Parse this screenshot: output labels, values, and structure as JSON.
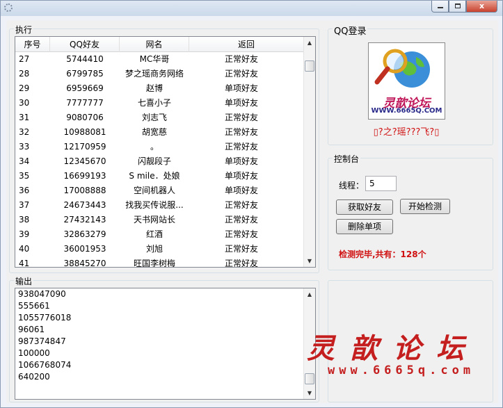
{
  "window": {
    "minimize_label": "",
    "maximize_label": "",
    "close_label": "x"
  },
  "exec_group": {
    "label": "执行"
  },
  "table": {
    "headers": [
      "序号",
      "QQ好友",
      "网名",
      "返回"
    ],
    "rows": [
      [
        "27",
        "5744410",
        "MC华哥",
        "正常好友"
      ],
      [
        "28",
        "6799785",
        "梦之瑶商务网络",
        "正常好友"
      ],
      [
        "29",
        "6959669",
        "赵博",
        "单项好友"
      ],
      [
        "30",
        "7777777",
        "七喜小子",
        "单项好友"
      ],
      [
        "31",
        "9080706",
        "刘志飞",
        "正常好友"
      ],
      [
        "32",
        "10988081",
        "胡宽慈",
        "正常好友"
      ],
      [
        "33",
        "12170959",
        "。",
        "正常好友"
      ],
      [
        "34",
        "12345670",
        "闪靓段子",
        "单项好友"
      ],
      [
        "35",
        "16699193",
        "S mile．处娘",
        "单项好友"
      ],
      [
        "36",
        "17008888",
        "空间机器人",
        "单项好友"
      ],
      [
        "37",
        "24673443",
        "找我买传说服...",
        "正常好友"
      ],
      [
        "38",
        "27432143",
        "天书网站长",
        "正常好友"
      ],
      [
        "39",
        "32863279",
        "红酒",
        "正常好友"
      ],
      [
        "40",
        "36001953",
        "刘旭",
        "正常好友"
      ],
      [
        "41",
        "38845270",
        "旺国李树梅",
        "正常好友"
      ]
    ]
  },
  "output_group": {
    "label": "输出",
    "lines": [
      "938047090",
      "555661",
      "1055776018",
      "96061",
      "987374847",
      "100000",
      "1066768074",
      "640200"
    ]
  },
  "login_group": {
    "label": "QQ登录",
    "logo_text": "灵歆论坛",
    "logo_url": "WWW.6665Q.COM",
    "nickname": "▯?之?瑶???飞?▯"
  },
  "console_group": {
    "label": "控制台",
    "threads_label": "线程：",
    "threads_value": "5",
    "get_friends_button": "获取好友",
    "start_check_button": "开始检测",
    "delete_single_button": "删除单项",
    "status": "检测完毕,共有：128个"
  },
  "watermark": {
    "text": "灵歆论坛",
    "url": "www.6665q.com"
  },
  "colors": {
    "status_red": "#d01010",
    "watermark_red": "#c41e1e"
  }
}
